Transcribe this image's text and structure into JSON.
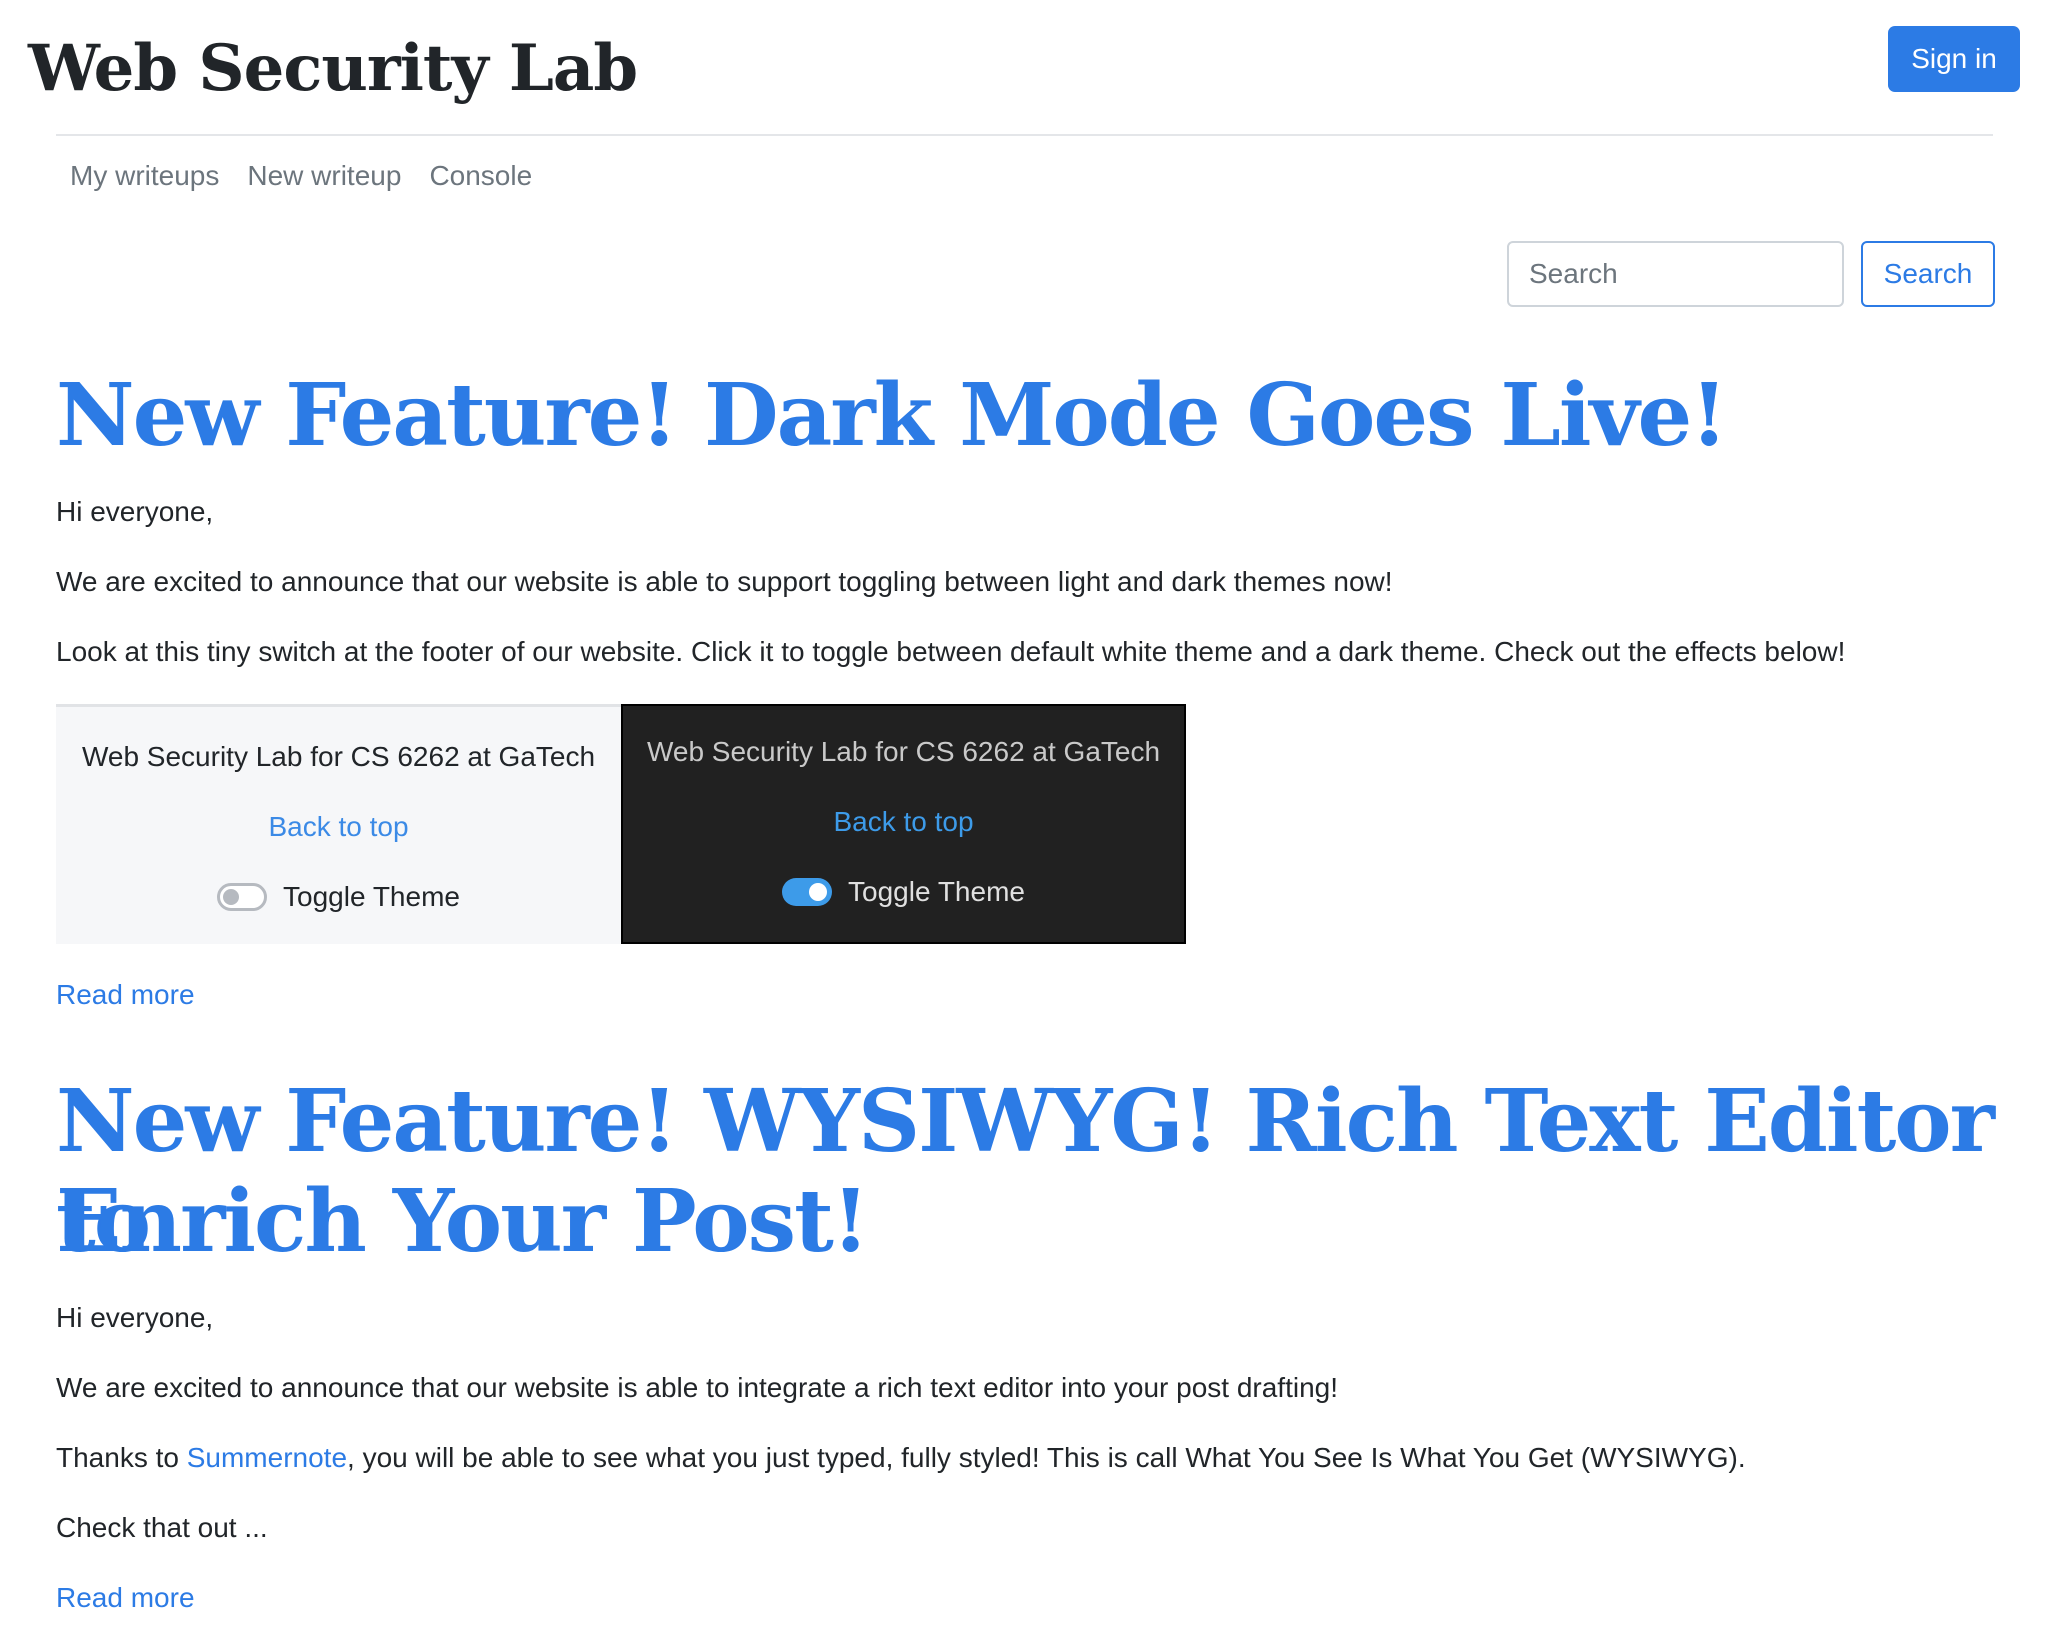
{
  "header": {
    "site_title": "Web Security Lab",
    "signin_label": "Sign in"
  },
  "nav": {
    "items": [
      "My writeups",
      "New writeup",
      "Console"
    ]
  },
  "search": {
    "placeholder": "Search",
    "button_label": "Search"
  },
  "posts": [
    {
      "title": "New Feature! Dark Mode Goes Live!",
      "greeting": "Hi everyone,",
      "para1": "We are excited to announce that our website is able to support toggling between light and dark themes now!",
      "para2": "Look at this tiny switch at the footer of our website. Click it to toggle between default white theme and a dark theme. Check out the effects below!",
      "preview": {
        "light": {
          "footer_text": "Web Security Lab for CS 6262 at GaTech",
          "back_to_top": "Back to top",
          "toggle_label": "Toggle Theme",
          "toggle_on": false
        },
        "dark": {
          "footer_text": "Web Security Lab for CS 6262 at GaTech",
          "back_to_top": "Back to top",
          "toggle_label": "Toggle Theme",
          "toggle_on": true
        }
      },
      "read_more": "Read more"
    },
    {
      "title_line1": "New Feature! WYSIWYG! Rich Text Editor to",
      "title_line2": "Enrich Your Post!",
      "greeting": "Hi everyone,",
      "para1": "We are excited to announce that our website is able to integrate a rich text editor into your post drafting!",
      "para2_pre": "Thanks to ",
      "para2_link": "Summernote",
      "para2_post": ", you will be able to see what you just typed, fully styled! This is call What You See Is What You Get (WYSIWYG).",
      "para3": "Check that out ...",
      "read_more": "Read more"
    }
  ],
  "colors": {
    "accent": "#2c7be5",
    "muted": "#6c757d",
    "dark_pane_bg": "#212121",
    "light_pane_bg": "#f6f7f9"
  }
}
